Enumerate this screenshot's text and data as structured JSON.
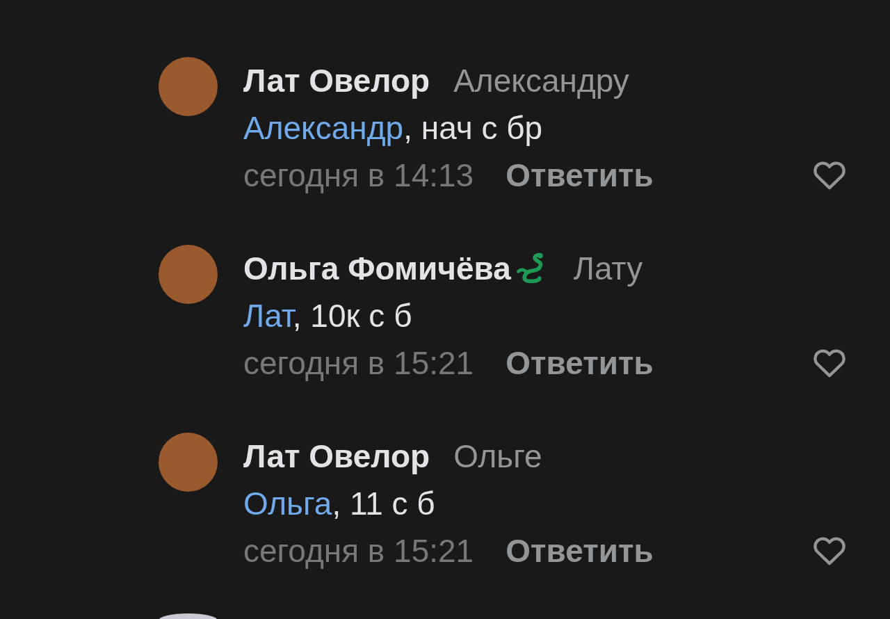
{
  "comments": [
    {
      "author": "Лат Овелор",
      "reply_to": "Александру",
      "badge": false,
      "mention": "Александр",
      "text": ", нач с бр",
      "time": "сегодня в 14:13",
      "reply": "Ответить"
    },
    {
      "author": "Ольга Фомичёва",
      "reply_to": "Лату",
      "badge": true,
      "mention": "Лат",
      "text": ", 10к с б",
      "time": "сегодня в 15:21",
      "reply": "Ответить"
    },
    {
      "author": "Лат Овелор",
      "reply_to": "Ольге",
      "badge": false,
      "mention": "Ольга",
      "text": ", 11 с б",
      "time": "сегодня в 15:21",
      "reply": "Ответить"
    }
  ],
  "more_below": true
}
